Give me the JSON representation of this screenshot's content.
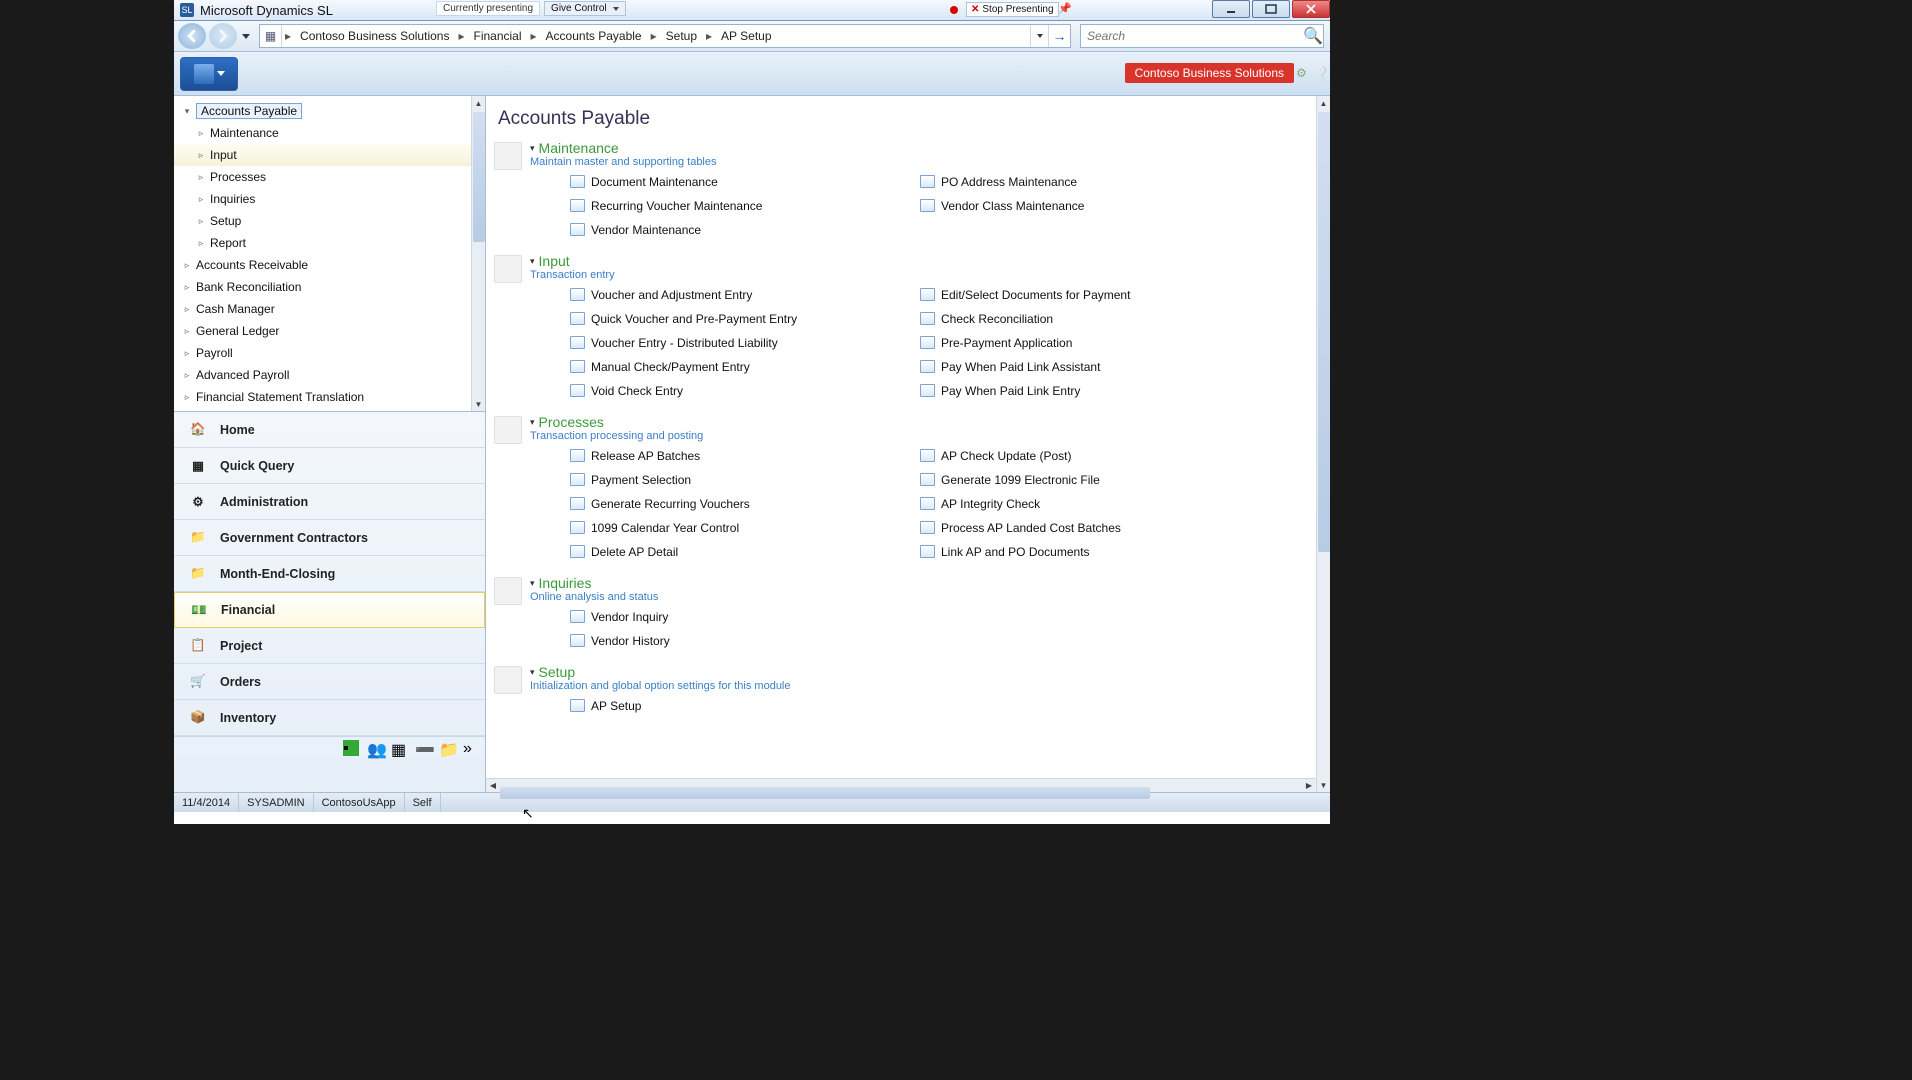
{
  "titlebar": {
    "app_name": "Microsoft Dynamics SL",
    "presenting_label": "Currently presenting",
    "give_control": "Give Control",
    "stop_presenting": "Stop Presenting"
  },
  "breadcrumb": {
    "items": [
      "Contoso Business Solutions",
      "Financial",
      "Accounts Payable",
      "Setup",
      "AP Setup"
    ]
  },
  "search": {
    "placeholder": "Search"
  },
  "ribbon": {
    "company_badge": "Contoso Business Solutions"
  },
  "tree": {
    "root": "Accounts Payable",
    "children": [
      "Maintenance",
      "Input",
      "Processes",
      "Inquiries",
      "Setup",
      "Report"
    ],
    "siblings": [
      "Accounts Receivable",
      "Bank Reconciliation",
      "Cash Manager",
      "General Ledger",
      "Payroll",
      "Advanced Payroll",
      "Financial Statement Translation"
    ]
  },
  "outlook": {
    "items": [
      {
        "label": "Home",
        "icon": "home"
      },
      {
        "label": "Quick Query",
        "icon": "table"
      },
      {
        "label": "Administration",
        "icon": "gears"
      },
      {
        "label": "Government Contractors",
        "icon": "folder"
      },
      {
        "label": "Month-End-Closing",
        "icon": "folder"
      },
      {
        "label": "Financial",
        "icon": "money",
        "active": true
      },
      {
        "label": "Project",
        "icon": "clipboard"
      },
      {
        "label": "Orders",
        "icon": "cart"
      },
      {
        "label": "Inventory",
        "icon": "box"
      }
    ]
  },
  "content": {
    "title": "Accounts Payable",
    "sections": [
      {
        "title": "Maintenance",
        "subtitle": "Maintain master and supporting tables",
        "links_left": [
          "Document Maintenance",
          "Recurring Voucher Maintenance",
          "Vendor Maintenance"
        ],
        "links_right": [
          "PO Address Maintenance",
          "Vendor Class Maintenance"
        ]
      },
      {
        "title": "Input",
        "subtitle": "Transaction entry",
        "links_left": [
          "Voucher and Adjustment Entry",
          "Quick Voucher and Pre-Payment Entry",
          "Voucher Entry - Distributed Liability",
          "Manual Check/Payment Entry",
          "Void Check Entry"
        ],
        "links_right": [
          "Edit/Select Documents for Payment",
          "Check Reconciliation",
          "Pre-Payment Application",
          "Pay When Paid Link Assistant",
          "Pay When Paid Link Entry"
        ]
      },
      {
        "title": "Processes",
        "subtitle": "Transaction processing and posting",
        "links_left": [
          "Release AP Batches",
          "Payment Selection",
          "Generate Recurring Vouchers",
          "1099 Calendar Year Control",
          "Delete AP Detail"
        ],
        "links_right": [
          "AP Check Update (Post)",
          "Generate 1099 Electronic File",
          "AP Integrity Check",
          "Process AP Landed Cost Batches",
          "Link AP and PO Documents"
        ]
      },
      {
        "title": "Inquiries",
        "subtitle": "Online analysis and status",
        "links_left": [
          "Vendor Inquiry",
          "Vendor History"
        ],
        "links_right": []
      },
      {
        "title": "Setup",
        "subtitle": "Initialization and global option settings for this module",
        "links_left": [
          "AP Setup"
        ],
        "links_right": []
      }
    ]
  },
  "statusbar": {
    "date": "11/4/2014",
    "user": "SYSADMIN",
    "db": "ContosoUsApp",
    "mode": "Self"
  }
}
